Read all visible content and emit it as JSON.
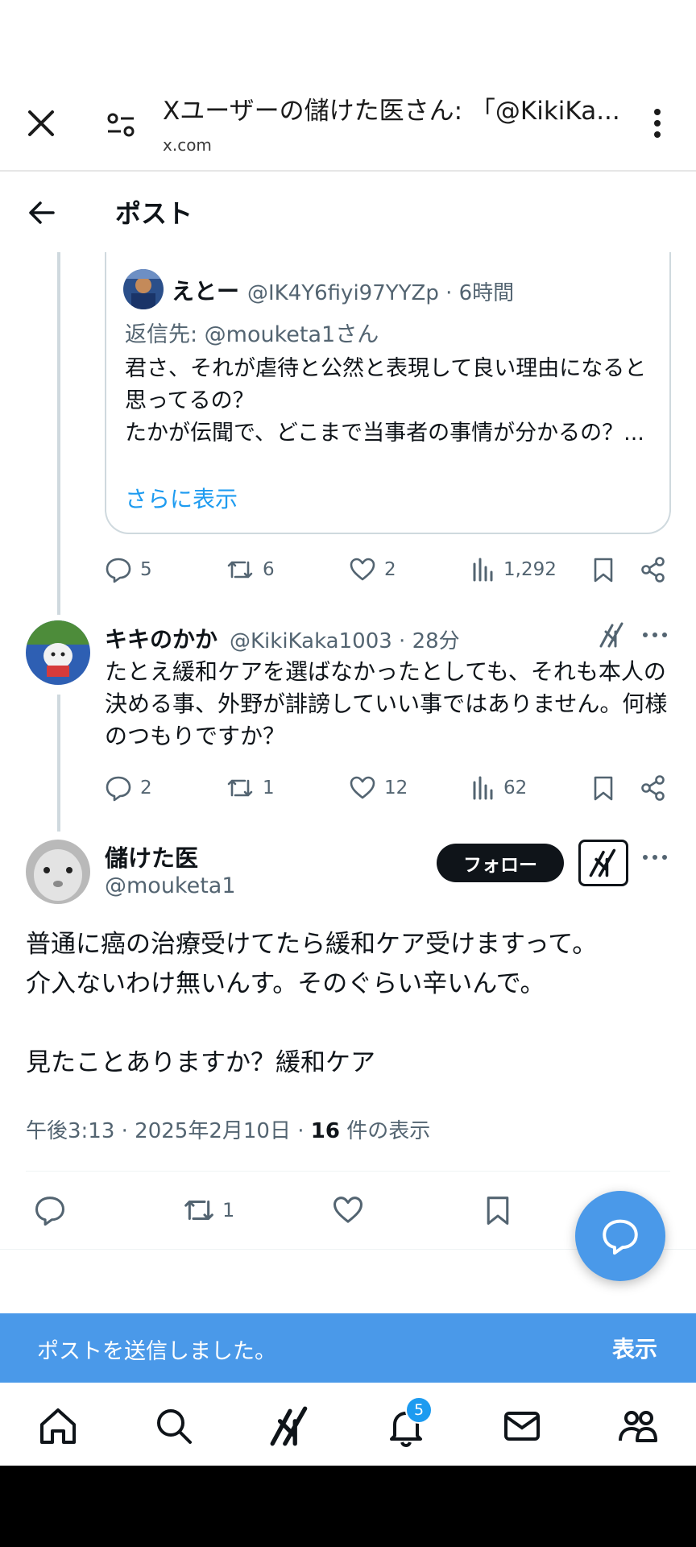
{
  "browser": {
    "title": "Xユーザーの儲けた医さん: 「@KikiKa...",
    "domain": "x.com"
  },
  "post_header": {
    "title": "ポスト"
  },
  "quoted_post": {
    "name": "えとー",
    "handle_time": "@IK4Y6fiyi97YYZp · 6時間",
    "reply_to": "返信先: @mouketa1さん",
    "body": "君さ、それが虐待と公然と表現して良い理由になると思ってるの？\nたかが伝聞で、どこまで当事者の事情が分かるの？...",
    "show_more": "さらに表示",
    "stats": {
      "replies": "5",
      "reposts": "6",
      "likes": "2",
      "views": "1,292"
    }
  },
  "reply_post": {
    "name": "キキのかか",
    "handle_time": "@KikiKaka1003 · 28分",
    "body": "たとえ緩和ケアを選ばなかったとしても、それも本人の決める事、外野が誹謗していい事ではありません。何様のつもりですか？",
    "stats": {
      "replies": "2",
      "reposts": "1",
      "likes": "12",
      "views": "62"
    }
  },
  "main_post": {
    "name": "儲けた医",
    "handle": "@mouketa1",
    "follow_label": "フォロー",
    "body": "普通に癌の治療受けてたら緩和ケア受けますって。\n介入ないわけ無いんす。そのぐらい辛いんで。\n\n見たことありますか？緩和ケア",
    "meta_prefix": "午後3:13 · 2025年2月10日 · ",
    "meta_count": "16",
    "meta_suffix": " 件の表示",
    "stats": {
      "reposts": "1"
    }
  },
  "toast": {
    "message": "ポストを送信しました。",
    "action": "表示"
  },
  "nav": {
    "notification_count": "5",
    "items": [
      "home-icon",
      "search-icon",
      "grok-icon",
      "bell-icon",
      "mail-icon",
      "communities-icon"
    ]
  },
  "colors": {
    "accent": "#1d9bf0",
    "toast_bg": "#4a99e9",
    "text_secondary": "#536471"
  }
}
